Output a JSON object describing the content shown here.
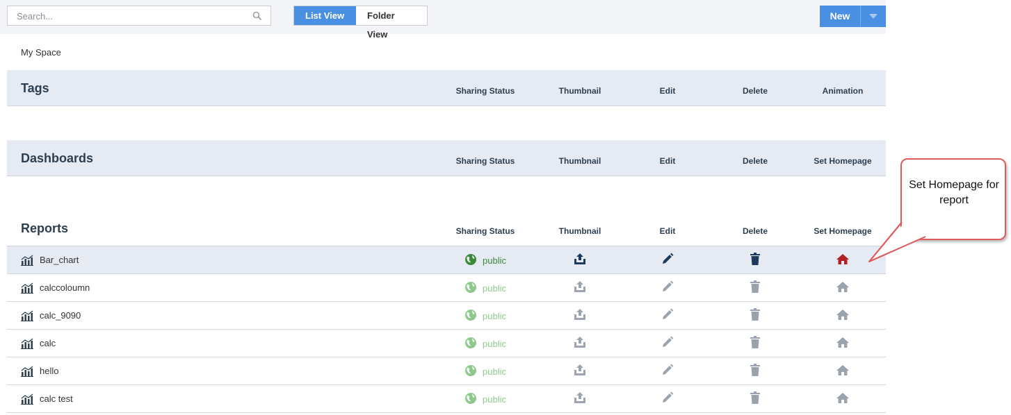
{
  "toolbar": {
    "search_placeholder": "Search...",
    "list_view_label": "List View",
    "folder_view_label": "Folder View",
    "new_label": "New"
  },
  "breadcrumb": "My Space",
  "sections": {
    "tags": {
      "title": "Tags",
      "columns": [
        "Sharing Status",
        "Thumbnail",
        "Edit",
        "Delete",
        "Animation"
      ]
    },
    "dashboards": {
      "title": "Dashboards",
      "columns": [
        "Sharing Status",
        "Thumbnail",
        "Edit",
        "Delete",
        "Set Homepage"
      ]
    },
    "reports": {
      "title": "Reports",
      "columns": [
        "Sharing Status",
        "Thumbnail",
        "Edit",
        "Delete",
        "Set Homepage"
      ]
    }
  },
  "reports": [
    {
      "name": "Bar_chart",
      "sharing": "public",
      "selected": true
    },
    {
      "name": "calccoloumn",
      "sharing": "public",
      "selected": false
    },
    {
      "name": "calc_9090",
      "sharing": "public",
      "selected": false
    },
    {
      "name": "calc",
      "sharing": "public",
      "selected": false
    },
    {
      "name": "hello",
      "sharing": "public",
      "selected": false
    },
    {
      "name": "calc test",
      "sharing": "public",
      "selected": false
    }
  ],
  "callout": {
    "text": "Set Homepage for report"
  },
  "colors": {
    "accent": "#4a90e2",
    "header_text": "#2c3e50",
    "public_active": "#3a8a3a",
    "public_dim": "#8fc98f",
    "home_active": "#b22222",
    "icon_active": "#1f3a5f",
    "icon_dim": "#9aa3ae",
    "callout_border": "#e05a5a"
  },
  "icons": {
    "search": "search-icon",
    "globe": "globe-icon",
    "thumbnail": "upload-tray-icon",
    "edit": "pencil-icon",
    "delete": "trash-icon",
    "home": "home-icon",
    "report": "bar-chart-icon"
  }
}
